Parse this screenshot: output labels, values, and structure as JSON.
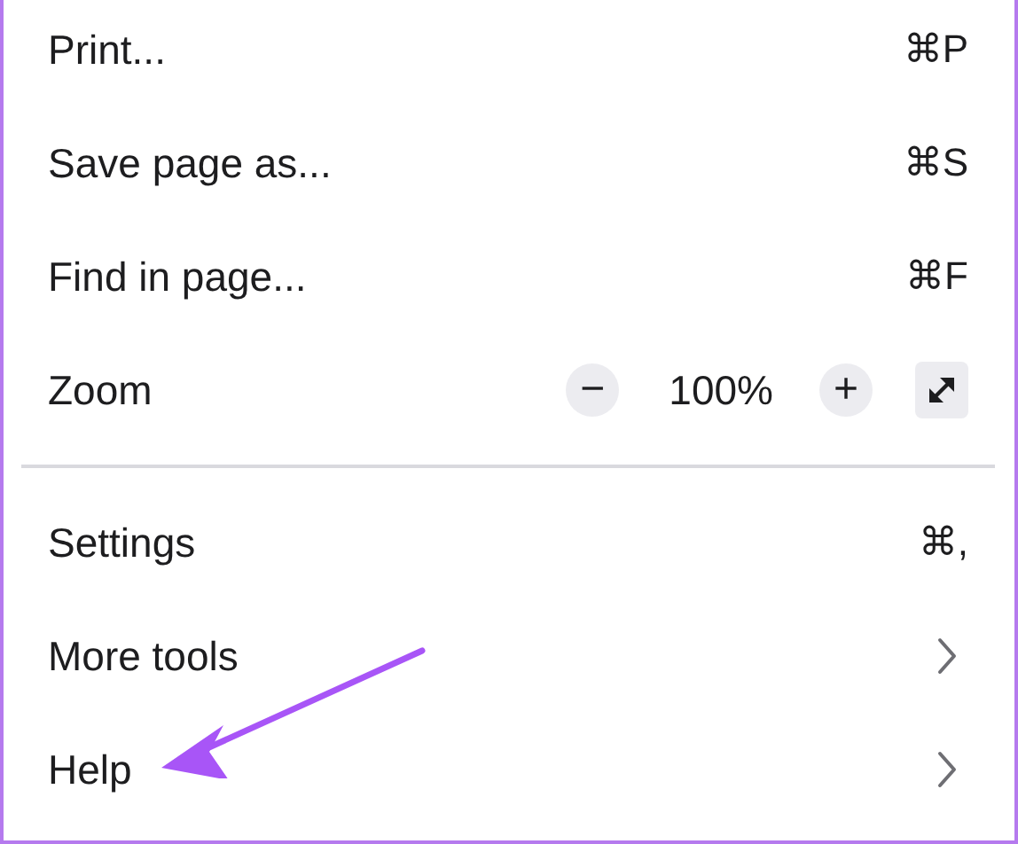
{
  "sections": [
    {
      "items": [
        {
          "kind": "shortcut",
          "label": "Print...",
          "shortcut": "⌘P"
        },
        {
          "kind": "shortcut",
          "label": "Save page as...",
          "shortcut": "⌘S"
        },
        {
          "kind": "shortcut",
          "label": "Find in page...",
          "shortcut": "⌘F"
        },
        {
          "kind": "zoom",
          "label": "Zoom",
          "minus": "−",
          "value": "100%",
          "plus": "+"
        }
      ]
    },
    {
      "items": [
        {
          "kind": "shortcut",
          "label": "Settings",
          "shortcut": "⌘,"
        },
        {
          "kind": "submenu",
          "label": "More tools"
        },
        {
          "kind": "submenu",
          "label": "Help"
        }
      ]
    }
  ]
}
